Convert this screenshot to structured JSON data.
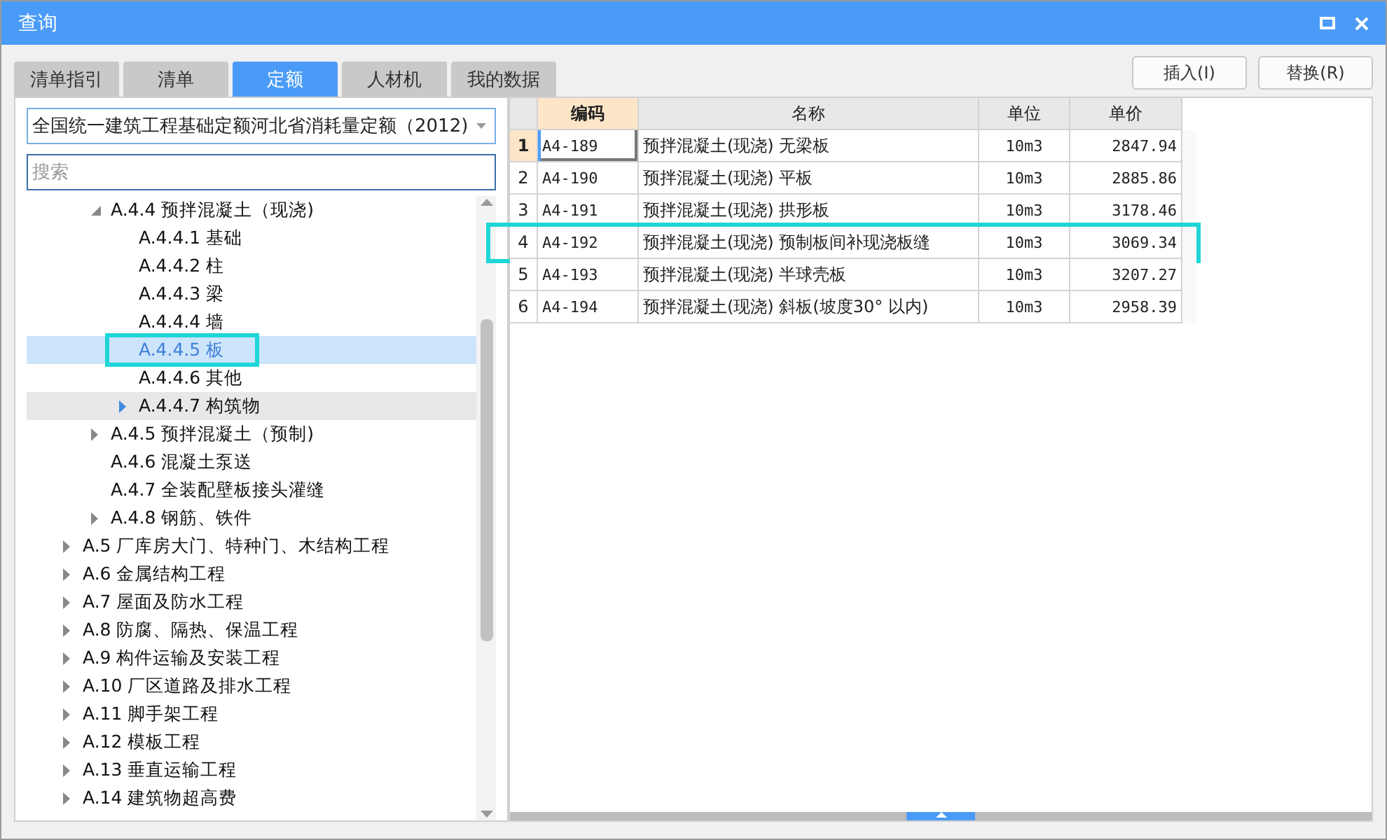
{
  "window": {
    "title": "查询"
  },
  "toolbar_buttons": [
    "插入(I)",
    "替换(R)"
  ],
  "tabs": [
    {
      "label": "清单指引",
      "selected": false
    },
    {
      "label": "清单",
      "selected": false
    },
    {
      "label": "定额",
      "selected": true
    },
    {
      "label": "人材机",
      "selected": false
    },
    {
      "label": "我的数据",
      "selected": false
    }
  ],
  "library_select": {
    "value": "全国统一建筑工程基础定额河北省消耗量定额（2012)"
  },
  "search": {
    "placeholder": "搜索"
  },
  "tree": {
    "items": [
      {
        "children": [
          {
            "label": "A.4.4 预拌混凝土（现浇)",
            "kind": "folder",
            "expanded": true,
            "selected": false,
            "hovered": false,
            "highlighted": false,
            "children": [
              {
                "label": "A.4.4.1 基础",
                "kind": "leaf",
                "selected": false,
                "hovered": false,
                "highlighted": false
              },
              {
                "label": "A.4.4.2 柱",
                "kind": "leaf",
                "selected": false,
                "hovered": false,
                "highlighted": false
              },
              {
                "label": "A.4.4.3 梁",
                "kind": "leaf",
                "selected": false,
                "hovered": false,
                "highlighted": false
              },
              {
                "label": "A.4.4.4 墙",
                "kind": "leaf",
                "selected": false,
                "hovered": false,
                "highlighted": false
              },
              {
                "label": "A.4.4.5 板",
                "kind": "leaf",
                "selected": true,
                "hovered": false,
                "highlighted": true
              },
              {
                "label": "A.4.4.6 其他",
                "kind": "leaf",
                "selected": false,
                "hovered": false,
                "highlighted": false
              },
              {
                "label": "A.4.4.7 构筑物",
                "kind": "folder",
                "expanded": false,
                "selected": false,
                "hovered": true,
                "highlighted": false
              }
            ]
          },
          {
            "label": "A.4.5 预拌混凝土（预制)",
            "kind": "folder",
            "expanded": false,
            "selected": false,
            "hovered": false,
            "highlighted": false
          },
          {
            "label": "A.4.6 混凝土泵送",
            "kind": "leaf",
            "selected": false,
            "hovered": false,
            "highlighted": false
          },
          {
            "label": "A.4.7 全装配壁板接头灌缝",
            "kind": "leaf",
            "selected": false,
            "hovered": false,
            "highlighted": false
          },
          {
            "label": "A.4.8 钢筋、铁件",
            "kind": "folder",
            "expanded": false,
            "selected": false,
            "hovered": false,
            "highlighted": false
          }
        ]
      },
      {
        "label": "A.5 厂库房大门、特种门、木结构工程",
        "kind": "folder",
        "expanded": false,
        "selected": false,
        "hovered": false,
        "highlighted": false
      },
      {
        "label": "A.6 金属结构工程",
        "kind": "folder",
        "expanded": false,
        "selected": false,
        "hovered": false,
        "highlighted": false
      },
      {
        "label": "A.7 屋面及防水工程",
        "kind": "folder",
        "expanded": false,
        "selected": false,
        "hovered": false,
        "highlighted": false
      },
      {
        "label": "A.8 防腐、隔热、保温工程",
        "kind": "folder",
        "expanded": false,
        "selected": false,
        "hovered": false,
        "highlighted": false
      },
      {
        "label": "A.9 构件运输及安装工程",
        "kind": "folder",
        "expanded": false,
        "selected": false,
        "hovered": false,
        "highlighted": false
      },
      {
        "label": "A.10 厂区道路及排水工程",
        "kind": "folder",
        "expanded": false,
        "selected": false,
        "hovered": false,
        "highlighted": false
      },
      {
        "label": "A.11 脚手架工程",
        "kind": "folder",
        "expanded": false,
        "selected": false,
        "hovered": false,
        "highlighted": false
      },
      {
        "label": "A.12 模板工程",
        "kind": "folder",
        "expanded": false,
        "selected": false,
        "hovered": false,
        "highlighted": false
      },
      {
        "label": "A.13 垂直运输工程",
        "kind": "folder",
        "expanded": false,
        "selected": false,
        "hovered": false,
        "highlighted": false
      },
      {
        "label": "A.14 建筑物超高费",
        "kind": "folder",
        "expanded": false,
        "selected": false,
        "hovered": false,
        "highlighted": false
      }
    ]
  },
  "table": {
    "columns": [
      "编码",
      "名称",
      "单位",
      "单价"
    ],
    "rows": [
      {
        "index": "1",
        "code": "A4-189",
        "name": "预拌混凝土(现浇) 无梁板",
        "unit": "10m3",
        "price": "2847.94",
        "selected": true,
        "highlighted": false
      },
      {
        "index": "2",
        "code": "A4-190",
        "name": "预拌混凝土(现浇) 平板",
        "unit": "10m3",
        "price": "2885.86",
        "selected": false,
        "highlighted": false
      },
      {
        "index": "3",
        "code": "A4-191",
        "name": "预拌混凝土(现浇) 拱形板",
        "unit": "10m3",
        "price": "3178.46",
        "selected": false,
        "highlighted": false
      },
      {
        "index": "4",
        "code": "A4-192",
        "name": "预拌混凝土(现浇) 预制板间补现浇板缝",
        "unit": "10m3",
        "price": "3069.34",
        "selected": false,
        "highlighted": true
      },
      {
        "index": "5",
        "code": "A4-193",
        "name": "预拌混凝土(现浇) 半球壳板",
        "unit": "10m3",
        "price": "3207.27",
        "selected": false,
        "highlighted": false
      },
      {
        "index": "6",
        "code": "A4-194",
        "name": "预拌混凝土(现浇) 斜板(坡度30° 以内)",
        "unit": "10m3",
        "price": "2958.39",
        "selected": false,
        "highlighted": false
      }
    ]
  }
}
